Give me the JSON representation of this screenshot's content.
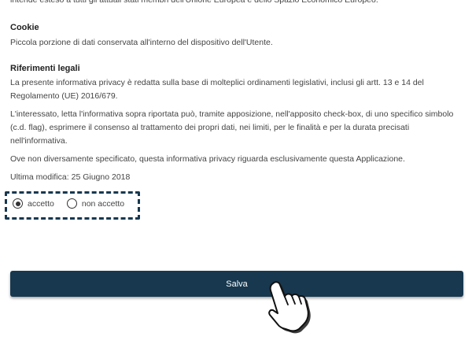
{
  "top_partial_line": "intende esteso a tutti gli attuali stati membri dell'Unione Europea e dello Spazio Economico Europeo.",
  "cookie": {
    "heading": "Cookie",
    "text": "Piccola porzione di dati conservata all'interno del dispositivo dell'Utente."
  },
  "legal": {
    "heading": "Riferimenti legali",
    "p1": "La presente informativa privacy è redatta sulla base di molteplici ordinamenti legislativi, inclusi gli artt. 13 e 14 del Regolamento (UE) 2016/679.",
    "p2": "L'interessato, letta l'informativa sopra riportata può, tramite apposizione, nell'apposito check-box, di uno specifico simbolo (c.d. flag), esprimere il consenso al trattamento dei propri dati, nei limiti, per le finalità e per la durata precisati nell'informativa.",
    "p3": "Ove non diversamente specificato, questa informativa privacy riguarda esclusivamente questa Applicazione.",
    "last_modified": "Ultima modifica: 25 Giugno 2018"
  },
  "consent": {
    "option_accept": "accetto",
    "option_decline": "non accetto",
    "selected": "accetto"
  },
  "save_label": "Salva",
  "colors": {
    "primary": "#17384f"
  }
}
